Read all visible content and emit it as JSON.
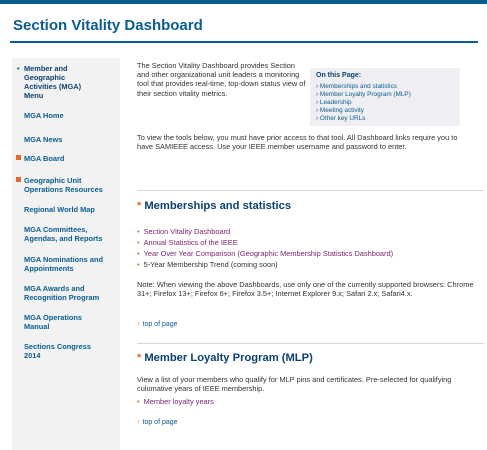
{
  "page": {
    "title": "Section Vitality Dashboard"
  },
  "sidebar": {
    "menu_title": "Member and Geographic Activities (MGA) Menu",
    "items": [
      "MGA Home",
      "MGA News",
      "MGA Board",
      "Geographic Unit Operations Resources",
      "Regional World Map",
      "MGA Committees, Agendas, and Reports",
      "MGA Nominations and Appointments",
      "MGA Awards and Recognition Program",
      "MGA Operations Manual",
      "Sections Congress 2014"
    ]
  },
  "intro": {
    "para1": "The Section Vitality Dashboard provides Section and other organizational unit leaders a monitoring tool that provides real-time, top-down status view of their section vitality metrics.",
    "para2": "To view the tools below, you must have prior access to that tool. All Dashboard links require you to have SAMIEEE access. Use your IEEE member username and password to enter."
  },
  "on_this_page": {
    "heading": "On this Page:",
    "links": [
      "Memberships and statistics",
      "Member Loyalty Program (MLP)",
      "Leadership",
      "Meeting activity",
      "Other key URLs"
    ]
  },
  "memberships": {
    "heading": "Memberships and statistics",
    "links": [
      "Section Vitality Dashboard",
      "Annual Statistics of the IEEE",
      "Year Over Year Comparison (Geographic Membership Statistics Dashboard)"
    ],
    "plain_item": "5-Year Membership Trend (coming soon)",
    "note": "Note: When viewing the above Dashboards, use only one of the currently supported browsers: Chrome 31+; Firefox 13+; Firefox 6+; Firefox 3.5+; Internet Explorer 9.x; Safari 2.x; Safari4.x.",
    "top_link": "top of page"
  },
  "mlp": {
    "heading": "Member Loyalty Program (MLP)",
    "description": "View a list of your members who qualify for MLP pins and certificates. Pre-selected for qualifying culumative years of IEEE membership.",
    "links": [
      "Member loyalty years"
    ],
    "top_link": "top of page"
  },
  "colors": {
    "brand_blue": "#0a5d8f",
    "accent_orange": "#e46a2b",
    "link_purple": "#7a1f6f"
  }
}
